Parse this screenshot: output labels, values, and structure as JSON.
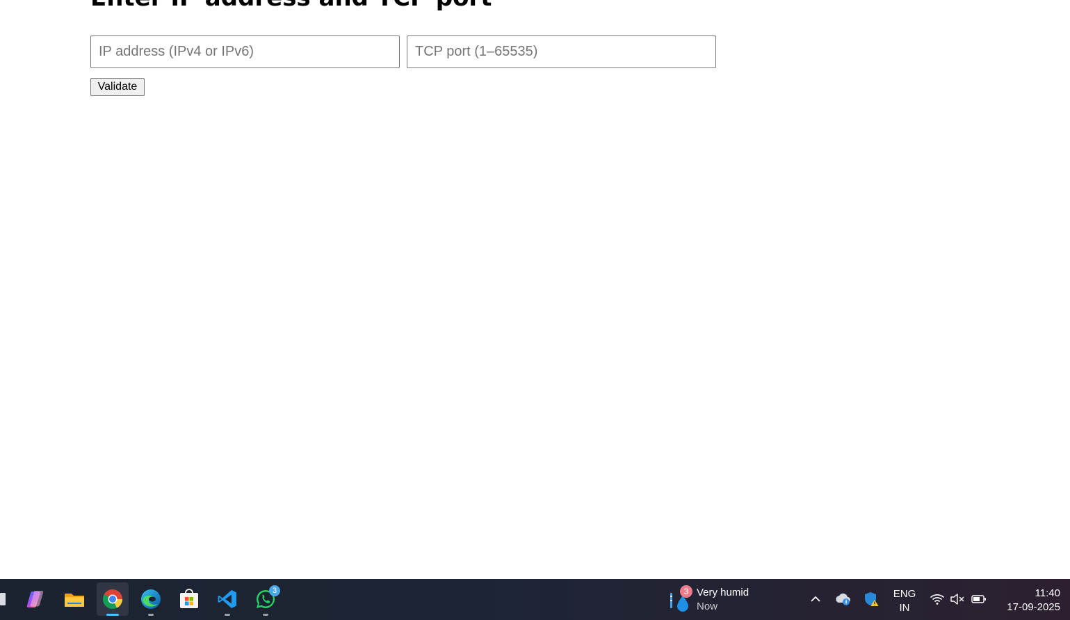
{
  "page": {
    "heading": "Enter IP address and TCP port",
    "ip_placeholder": "IP address (IPv4 or IPv6)",
    "port_placeholder": "TCP port (1–65535)",
    "ip_value": "",
    "port_value": "",
    "validate_label": "Validate"
  },
  "taskbar": {
    "apps": [
      {
        "name": "copilot-icon"
      },
      {
        "name": "file-explorer-icon"
      },
      {
        "name": "chrome-icon",
        "state": "active"
      },
      {
        "name": "edge-icon",
        "state": "open"
      },
      {
        "name": "microsoft-store-icon"
      },
      {
        "name": "vscode-icon",
        "state": "open"
      },
      {
        "name": "whatsapp-icon",
        "state": "open",
        "badge": "3"
      }
    ],
    "weather": {
      "badge": "3",
      "condition": "Very humid",
      "time": "Now"
    },
    "tray": {
      "lang_primary": "ENG",
      "lang_secondary": "IN",
      "icons": [
        "chevron-up-icon",
        "onedrive-icon",
        "windows-security-icon",
        "wifi-icon",
        "speaker-muted-icon",
        "battery-icon"
      ]
    },
    "clock": {
      "time": "11:40",
      "date": "17-09-2025"
    }
  },
  "colors": {
    "taskbar_bg": "#1d2534",
    "active_indicator": "#4cc2ff",
    "badge_blue": "#4aa8e8",
    "badge_pink": "#f07b8a"
  }
}
